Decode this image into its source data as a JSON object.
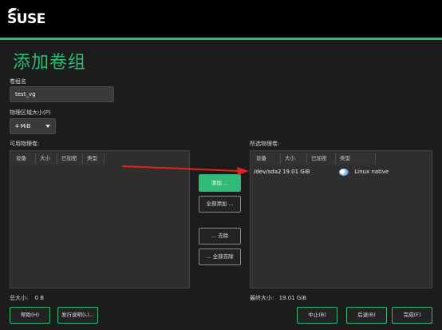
{
  "header": {
    "logo_text": "SUSE",
    "accent": "#30ba78"
  },
  "page_title": "添加卷组",
  "vg_name": {
    "label": "卷组名",
    "value": "test_vg"
  },
  "pe_size": {
    "label": "物理区域大小(P)",
    "value": "4 MiB"
  },
  "available": {
    "label": "可用物理卷:",
    "columns": [
      "设备",
      "大小",
      "已加密",
      "类型"
    ],
    "rows": [],
    "total_label": "总大小:",
    "total_value": "0 B"
  },
  "middle_buttons": {
    "add": "添加 ...",
    "add_all": "全部添加 ...",
    "remove": "... 去除",
    "remove_all": "... 全部去除"
  },
  "selected": {
    "label": "所选物理卷:",
    "columns": [
      "设备",
      "大小",
      "已加密",
      "类型"
    ],
    "rows": [
      {
        "device": "/dev/sda2",
        "size": "19.01 GiB",
        "encrypted": "",
        "type": "Linux native",
        "type_icon": "disk-icon"
      }
    ],
    "total_label": "最终大小:",
    "total_value": "19.01 GiB"
  },
  "footer": {
    "help": "帮助(H)",
    "release_notes": "发行说明(L)...",
    "abort": "中止(B)",
    "back": "后退(B)",
    "finish": "完成(F)"
  },
  "annotation": {
    "arrow_color": "#e62020"
  }
}
